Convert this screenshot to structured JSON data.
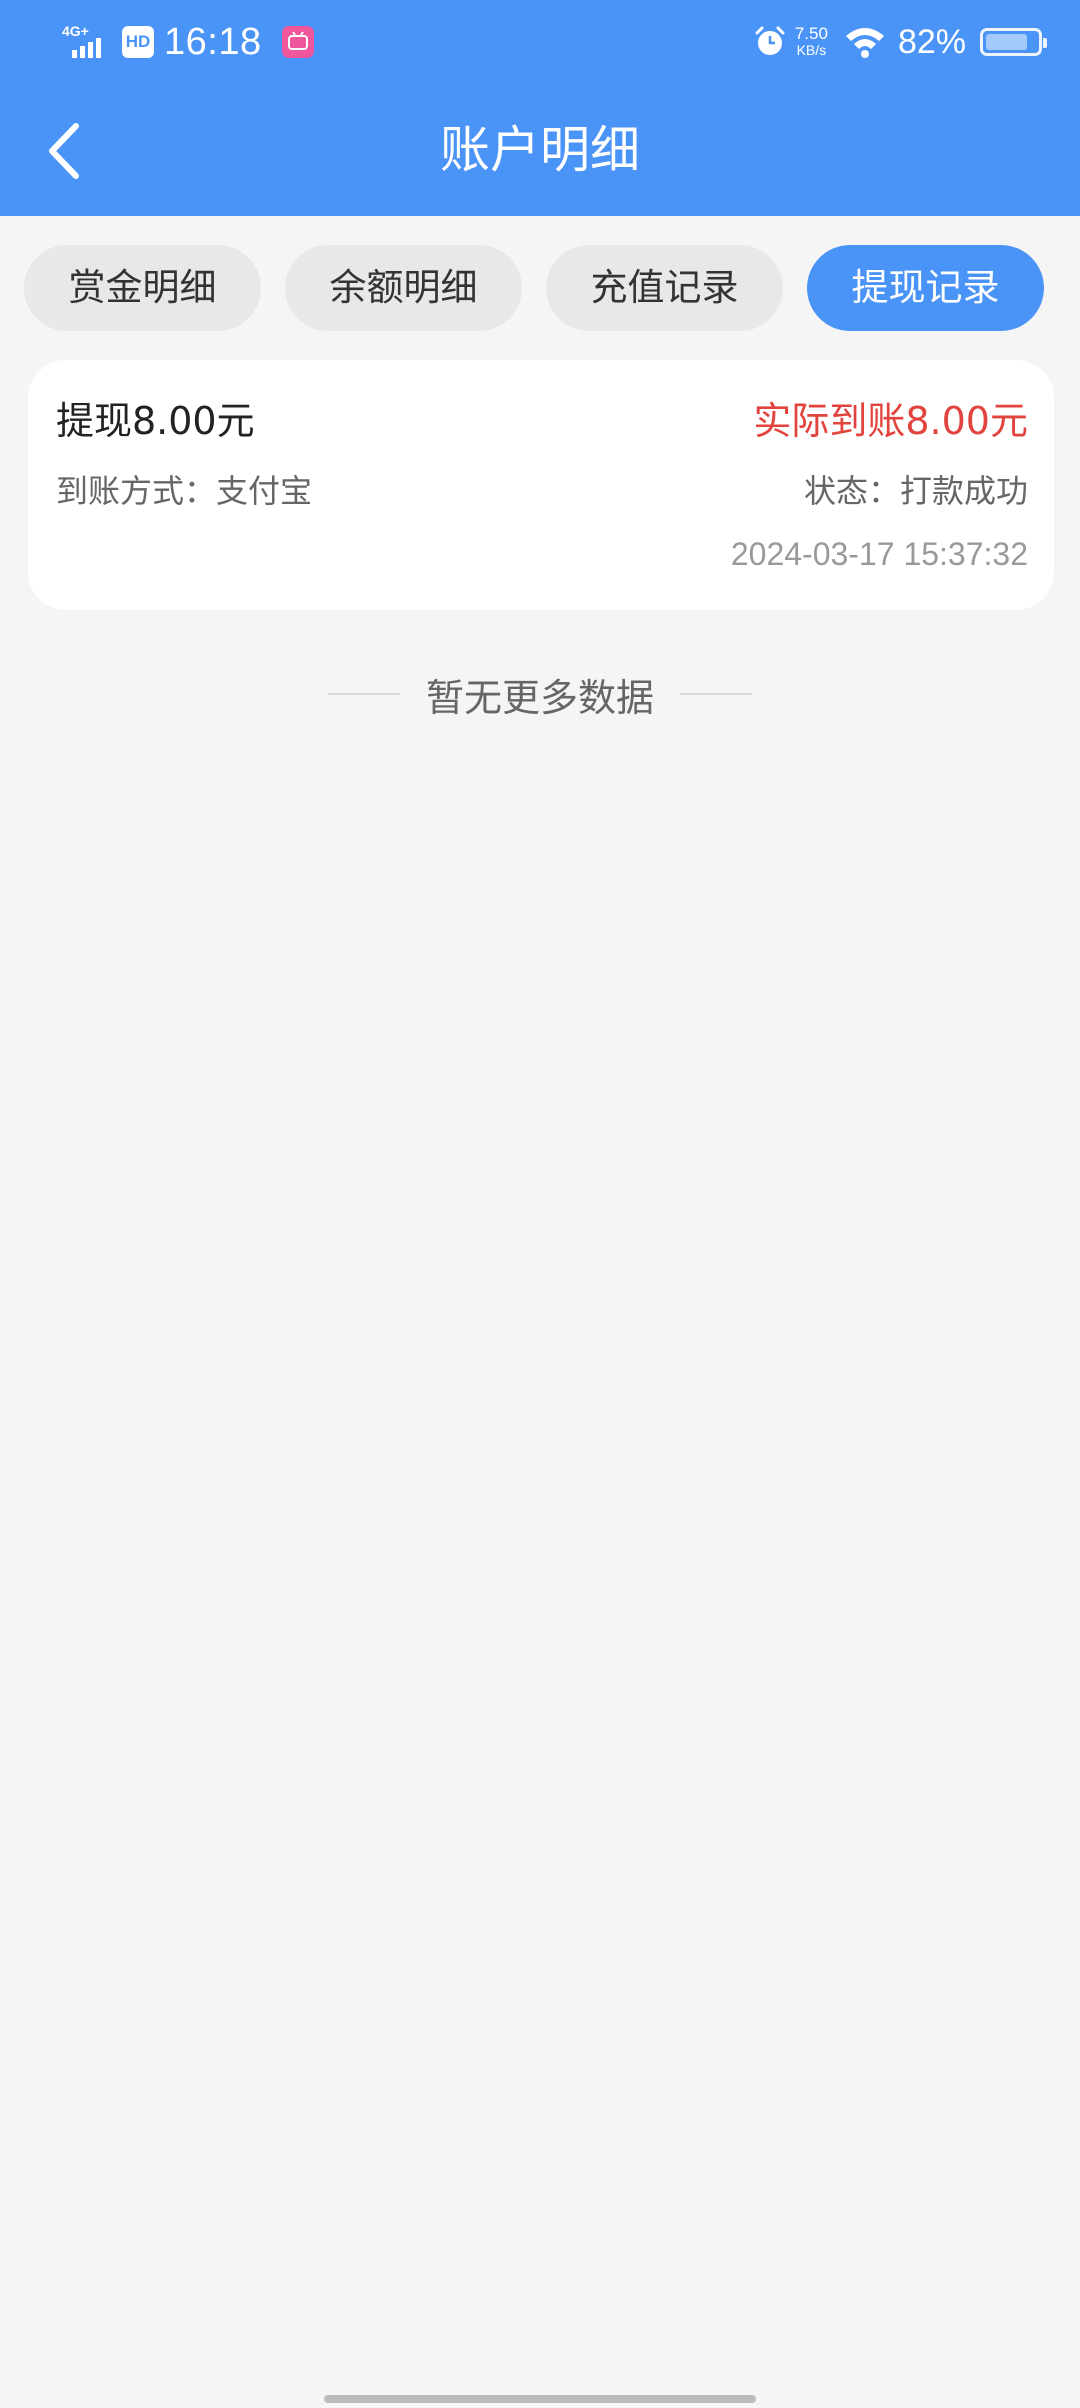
{
  "status_bar": {
    "network": "4G+",
    "hd": "HD",
    "time": "16:18",
    "app_icon": "bilibili-icon",
    "alarm_icon": "alarm-icon",
    "speed_value": "7.50",
    "speed_unit": "KB/s",
    "wifi_icon": "wifi-icon",
    "battery_percent": "82%",
    "battery_level": 0.82
  },
  "header": {
    "back_icon": "chevron-left-icon",
    "title": "账户明细"
  },
  "tabs": [
    {
      "label": "赏金明细",
      "active": false
    },
    {
      "label": "余额明细",
      "active": false
    },
    {
      "label": "充值记录",
      "active": false
    },
    {
      "label": "提现记录",
      "active": true
    }
  ],
  "records": [
    {
      "amount": "提现8.00元",
      "actual": "实际到账8.00元",
      "method": "到账方式：支付宝",
      "status": "状态：打款成功",
      "time": "2024-03-17 15:37:32"
    }
  ],
  "footer": {
    "no_more": "暂无更多数据"
  },
  "colors": {
    "primary": "#4b94f7",
    "highlight_red": "#e2433d",
    "background": "#f5f5f5"
  }
}
